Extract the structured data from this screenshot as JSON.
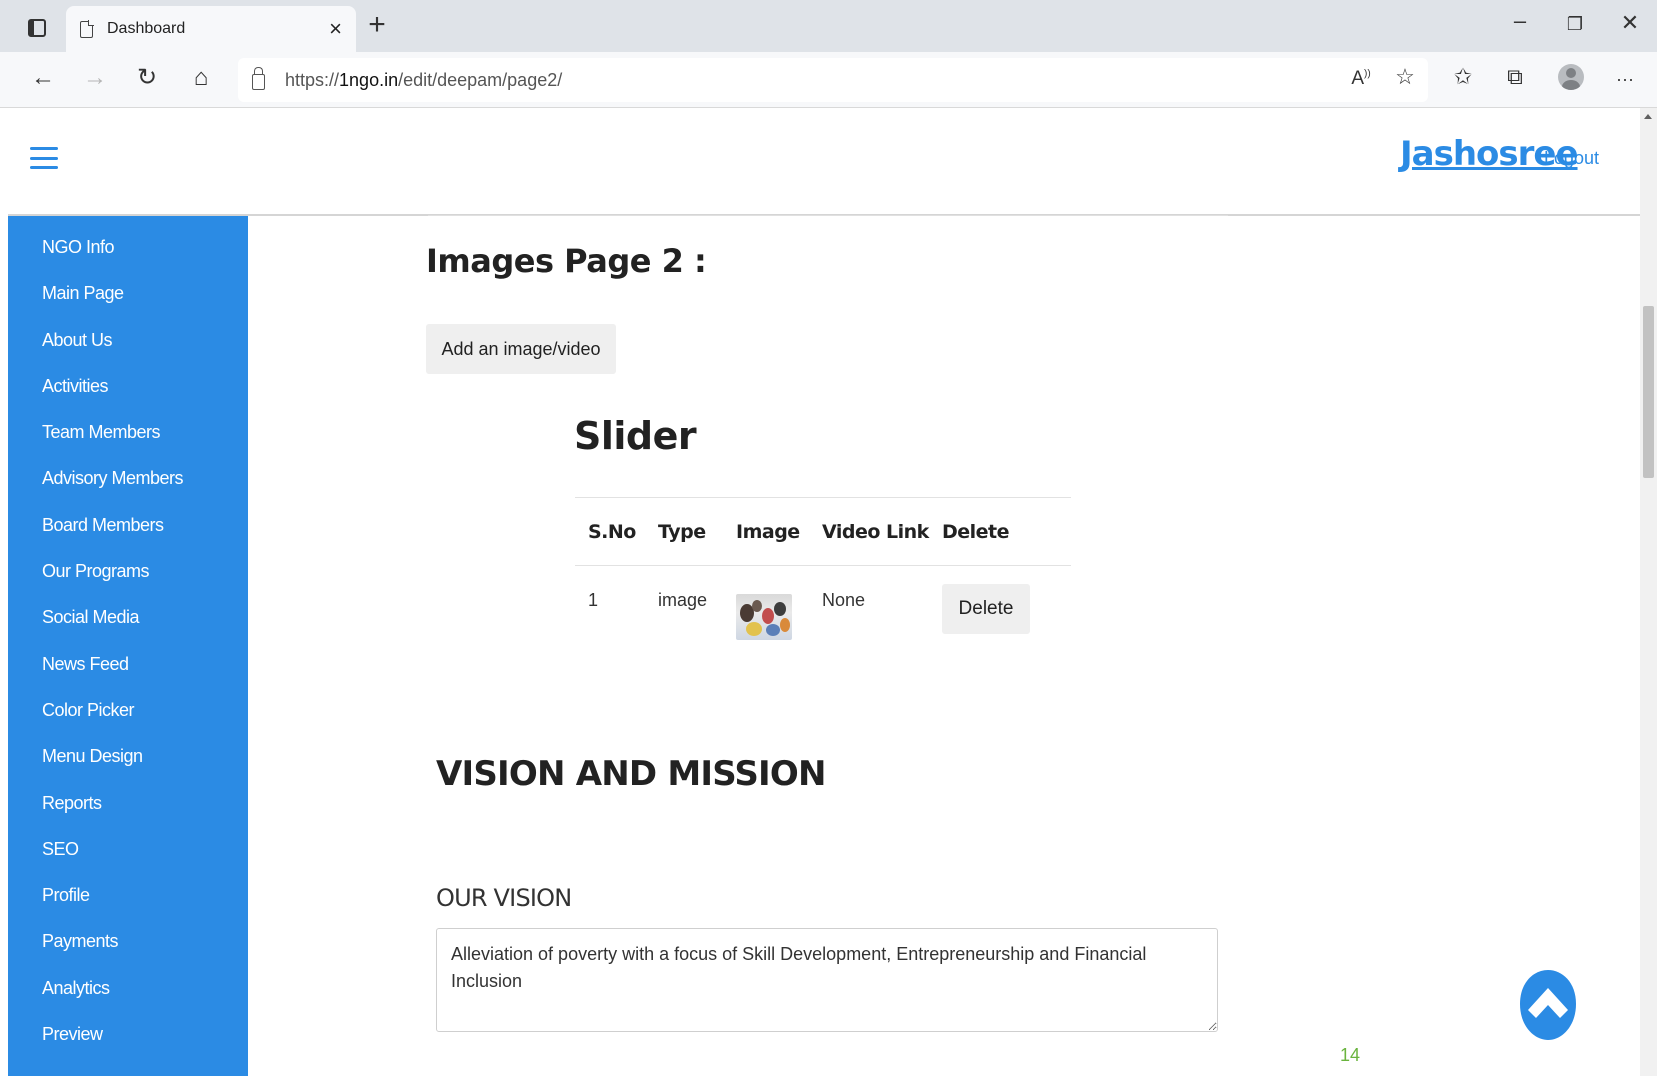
{
  "browser": {
    "tab_title": "Dashboard",
    "url_prefix": "https://",
    "url_domain": "1ngo.in",
    "url_path": "/edit/deepam/page2/"
  },
  "header": {
    "user_name": "Jashosree",
    "logout_label": "Logout"
  },
  "sidebar": {
    "items": [
      {
        "label": "NGO Info"
      },
      {
        "label": "Main Page"
      },
      {
        "label": "About Us"
      },
      {
        "label": "Activities"
      },
      {
        "label": "Team Members"
      },
      {
        "label": "Advisory Members"
      },
      {
        "label": "Board Members"
      },
      {
        "label": "Our Programs"
      },
      {
        "label": "Social Media"
      },
      {
        "label": "News Feed"
      },
      {
        "label": "Color Picker"
      },
      {
        "label": "Menu Design"
      },
      {
        "label": "Reports"
      },
      {
        "label": "SEO"
      },
      {
        "label": "Profile"
      },
      {
        "label": "Payments"
      },
      {
        "label": "Analytics"
      },
      {
        "label": "Preview"
      }
    ]
  },
  "main": {
    "title": "Images Page 2 :",
    "add_button_label": "Add an image/video",
    "slider": {
      "title": "Slider",
      "columns": [
        "S.No",
        "Type",
        "Image",
        "Video Link",
        "Delete"
      ],
      "rows": [
        {
          "sno": "1",
          "type": "image",
          "video_link": "None",
          "delete_label": "Delete"
        }
      ]
    },
    "vision_mission_title": "VISION AND MISSION",
    "vision_label": "OUR VISION",
    "vision_text": "Alleviation of poverty with a focus of Skill Development, Entrepreneurship and Financial Inclusion"
  },
  "footer": {
    "page_number": "14"
  },
  "colors": {
    "accent": "#2b8be4",
    "sidebar_bg": "#2b8be4",
    "page_number": "#6ab43e"
  }
}
